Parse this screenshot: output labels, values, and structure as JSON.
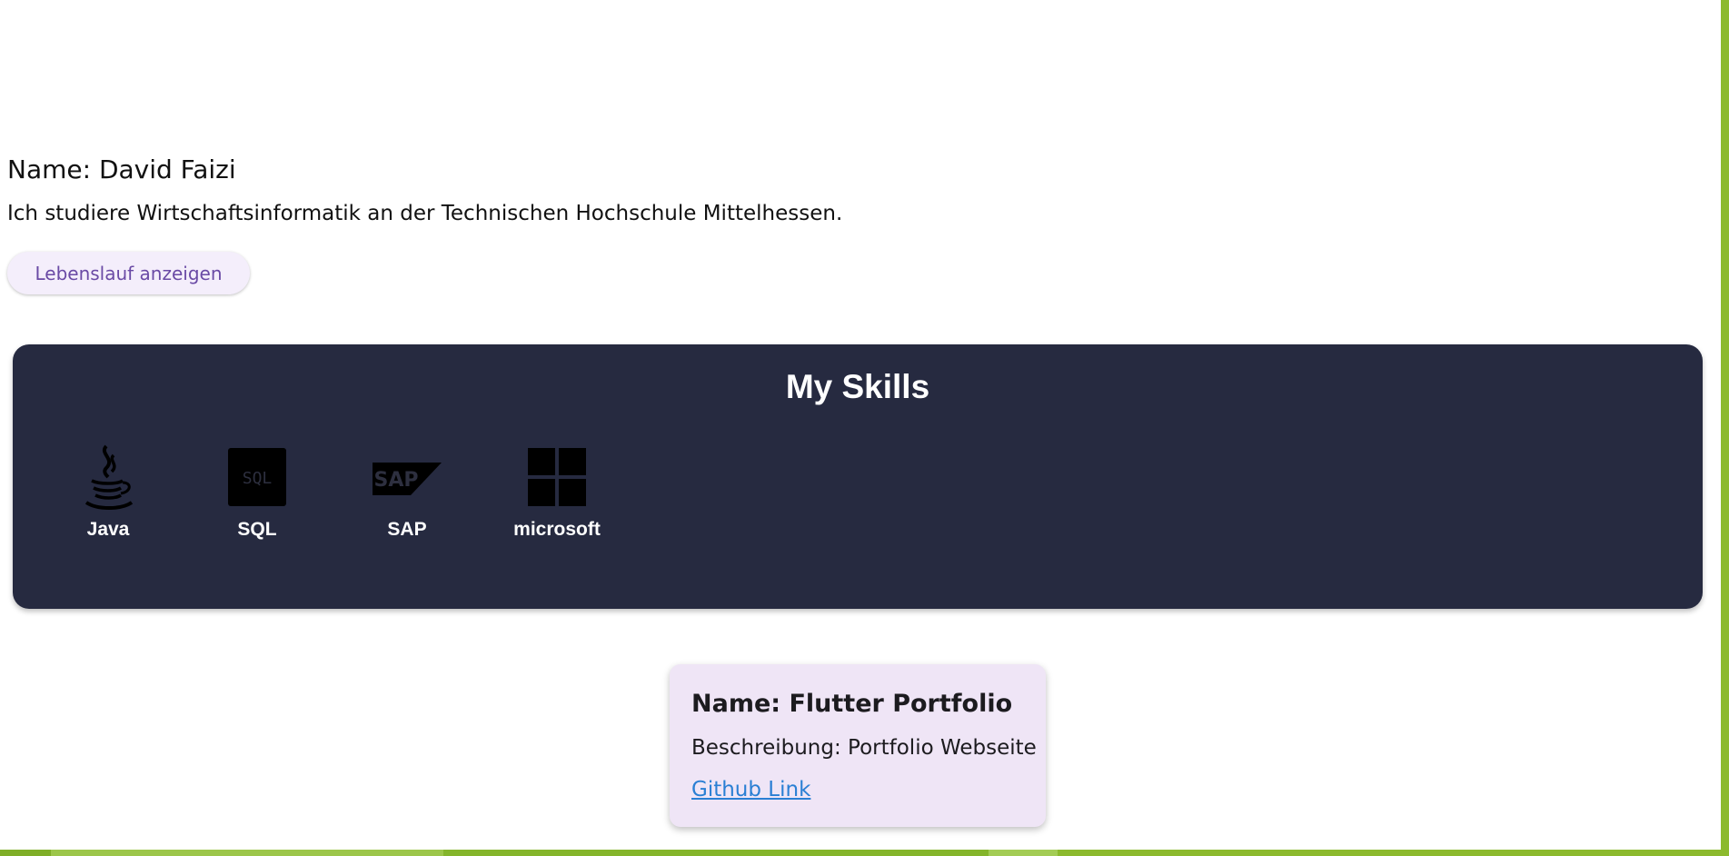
{
  "profile": {
    "name_line": "Name: David Faizi",
    "study_line": "Ich studiere Wirtschaftsinformatik an der Technischen Hochschule Mittelhessen.",
    "cv_button_label": "Lebenslauf anzeigen"
  },
  "skills": {
    "title": "My Skills",
    "items": [
      {
        "label": "Java",
        "icon": "java-icon"
      },
      {
        "label": "SQL",
        "icon": "sql-icon",
        "icon_text": "SQL"
      },
      {
        "label": "SAP",
        "icon": "sap-icon",
        "icon_text": "SAP"
      },
      {
        "label": "microsoft",
        "icon": "microsoft-icon"
      }
    ]
  },
  "project": {
    "name_line": "Name: Flutter Portfolio",
    "desc_line": "Beschreibung: Portfolio Webseite",
    "link_label": "Github Link"
  },
  "colors": {
    "accent_border": "#8cba2e",
    "skills_panel_bg": "#262a40",
    "project_card_bg": "#efe5f6",
    "button_text": "#6a4aa5",
    "link": "#2a7fd4"
  }
}
